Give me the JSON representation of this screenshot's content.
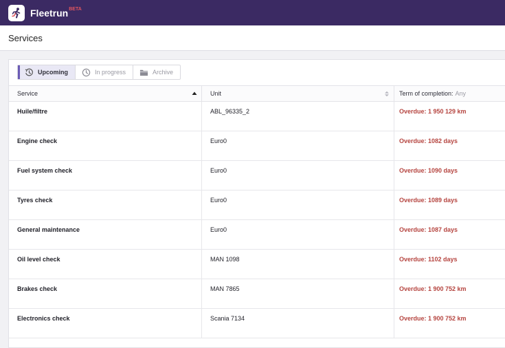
{
  "app": {
    "name": "Fleetrun",
    "badge": "BETA",
    "logo_icon": "runner-logo-icon"
  },
  "page": {
    "title": "Services"
  },
  "tabs": [
    {
      "label": "Upcoming",
      "icon": "clock-arrow-icon",
      "active": true
    },
    {
      "label": "In progress",
      "icon": "clock-icon",
      "active": false
    },
    {
      "label": "Archive",
      "icon": "folder-icon",
      "active": false
    }
  ],
  "table": {
    "columns": [
      {
        "label": "Service"
      },
      {
        "label": "Unit"
      },
      {
        "label": "Term of completion:",
        "filter": "Any"
      }
    ],
    "rows": [
      {
        "service": "Huile/filtre",
        "unit": "ABL_96335_2",
        "term": "Overdue: 1 950 129 km"
      },
      {
        "service": "Engine check",
        "unit": "Euro0",
        "term": "Overdue: 1082 days"
      },
      {
        "service": "Fuel system check",
        "unit": "Euro0",
        "term": "Overdue: 1090 days"
      },
      {
        "service": "Tyres check",
        "unit": "Euro0",
        "term": "Overdue: 1089 days"
      },
      {
        "service": "General maintenance",
        "unit": "Euro0",
        "term": "Overdue: 1087 days"
      },
      {
        "service": "Oil level check",
        "unit": "MAN 1098",
        "term": "Overdue: 1102 days"
      },
      {
        "service": "Brakes check",
        "unit": "MAN 7865",
        "term": "Overdue: 1 900 752 km"
      },
      {
        "service": "Electronics check",
        "unit": "Scania 7134",
        "term": "Overdue: 1 900 752 km"
      }
    ]
  },
  "colors": {
    "topbar": "#3b2a63",
    "overdue": "#b5443f",
    "accent": "#6b5bb5"
  }
}
